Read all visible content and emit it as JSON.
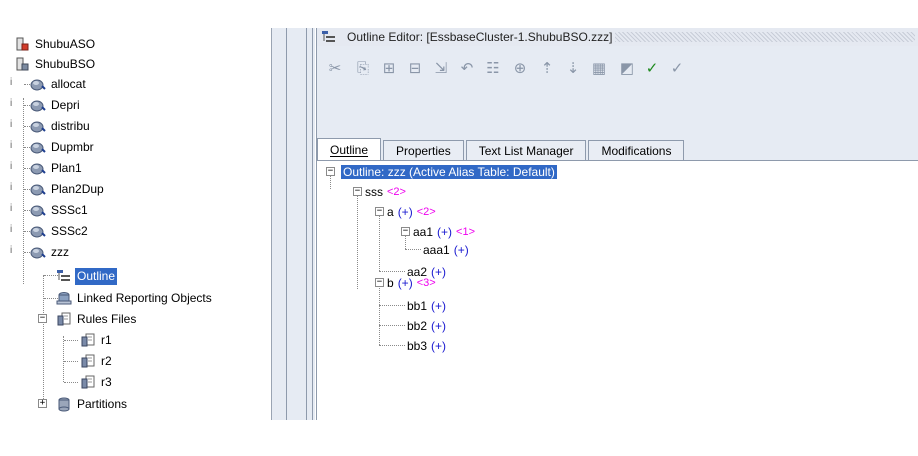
{
  "tree": {
    "apps": [
      {
        "label": "ShubuASO",
        "icon": "application-icon"
      },
      {
        "label": "ShubuBSO",
        "icon": "application-icon"
      }
    ],
    "databases": [
      {
        "label": "allocat"
      },
      {
        "label": "Depri"
      },
      {
        "label": "distribu"
      },
      {
        "label": "Dupmbr"
      },
      {
        "label": "Plan1"
      },
      {
        "label": "Plan2Dup"
      },
      {
        "label": "SSSc1"
      },
      {
        "label": "SSSc2"
      },
      {
        "label": "zzz"
      }
    ],
    "zzz_children": {
      "outline": "Outline",
      "lro": "Linked Reporting Objects",
      "rules": "Rules Files",
      "rules_items": [
        "r1",
        "r2",
        "r3"
      ],
      "partitions": "Partitions"
    },
    "selected": "Outline"
  },
  "editor": {
    "title": "Outline Editor: [EssbaseCluster-1.ShubuBSO.zzz]",
    "toolbar": [
      {
        "name": "cut-icon",
        "glyph": "✂",
        "enabled": false
      },
      {
        "name": "copy-icon",
        "glyph": "⎘",
        "enabled": false
      },
      {
        "name": "add-sibling-icon",
        "glyph": "⊞",
        "enabled": false
      },
      {
        "name": "add-child-icon",
        "glyph": "⊟",
        "enabled": false
      },
      {
        "name": "paste-icon",
        "glyph": "⇲",
        "enabled": false
      },
      {
        "name": "undo-icon",
        "glyph": "↶",
        "enabled": false
      },
      {
        "name": "restructure-icon",
        "glyph": "☷",
        "enabled": false
      },
      {
        "name": "add-member-icon",
        "glyph": "⊕",
        "enabled": false
      },
      {
        "name": "sort-ascending-icon",
        "glyph": "⇡",
        "enabled": false
      },
      {
        "name": "sort-descending-icon",
        "glyph": "⇣",
        "enabled": false
      },
      {
        "name": "calculator-icon",
        "glyph": "▦",
        "enabled": false
      },
      {
        "name": "save-icon",
        "glyph": "◩",
        "enabled": false
      },
      {
        "name": "verify-icon",
        "glyph": "✓",
        "enabled": true
      },
      {
        "name": "verify-options-icon",
        "glyph": "✓",
        "enabled": false
      }
    ],
    "tabs": [
      {
        "label": "Outline",
        "active": true
      },
      {
        "label": "Properties",
        "active": false
      },
      {
        "label": "Text List Manager",
        "active": false
      },
      {
        "label": "Modifications",
        "active": false
      }
    ],
    "outline": {
      "root": "Outline: zzz (Active Alias Table: Default)",
      "members": [
        {
          "name": "sss",
          "cons": "",
          "count": "<2>"
        },
        {
          "name": "a",
          "cons": "(+)",
          "count": "<2>"
        },
        {
          "name": "aa1",
          "cons": "(+)",
          "count": "<1>"
        },
        {
          "name": "aaa1",
          "cons": "(+)",
          "count": ""
        },
        {
          "name": "aa2",
          "cons": "(+)",
          "count": ""
        },
        {
          "name": "b",
          "cons": "(+)",
          "count": "<3>"
        },
        {
          "name": "bb1",
          "cons": "(+)",
          "count": ""
        },
        {
          "name": "bb2",
          "cons": "(+)",
          "count": ""
        },
        {
          "name": "bb3",
          "cons": "(+)",
          "count": ""
        }
      ]
    }
  },
  "colors": {
    "selection": "#3169c6",
    "consolidation": "#1a1ad0",
    "child_count": "#ee00ee",
    "panel": "#e6ebf3"
  }
}
